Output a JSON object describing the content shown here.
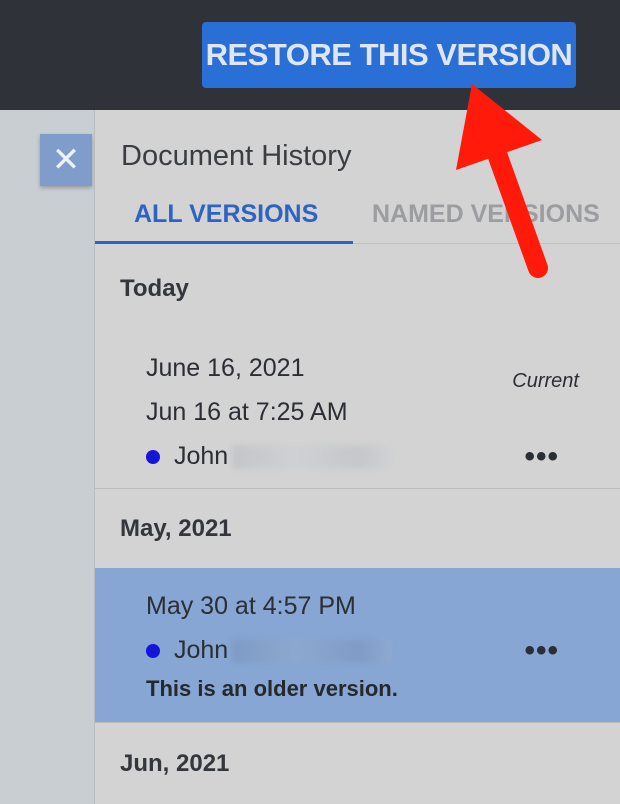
{
  "toolbar": {
    "restore_label": "RESTORE THIS VERSION"
  },
  "close": {
    "glyph": "✕"
  },
  "panel": {
    "title": "Document History",
    "tabs": [
      {
        "label": "ALL VERSIONS",
        "active": true
      },
      {
        "label": "NAMED VERSIONS",
        "active": false
      }
    ]
  },
  "groups": [
    {
      "header": "Today",
      "versions": [
        {
          "name": "June 16, 2021",
          "timestamp": "Jun 16 at 7:25 AM",
          "author": "John",
          "tag": "Current",
          "more": "•••"
        }
      ]
    },
    {
      "header": "May, 2021",
      "versions": [
        {
          "timestamp": "May 30 at 4:57 PM",
          "author": "John",
          "note": "This is an older version.",
          "more": "•••",
          "selected": true
        }
      ]
    },
    {
      "header": "Jun, 2021",
      "versions": []
    }
  ],
  "colors": {
    "topbar": "#2f3238",
    "accent": "#2a6fd6",
    "selected_row": "#87a6d3",
    "author_dot": "#1515d8",
    "annotation_arrow": "#ff1a0a"
  }
}
